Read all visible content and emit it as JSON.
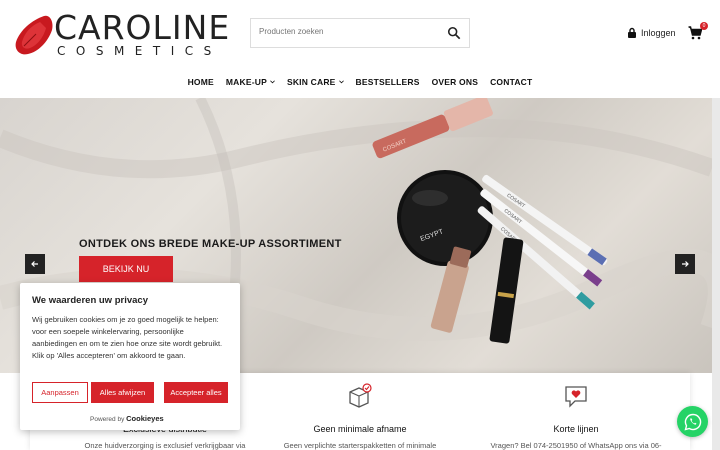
{
  "brand": {
    "name": "CAROLINE",
    "sub": "COSMETICS",
    "accent": "#d6232a"
  },
  "search": {
    "placeholder": "Producten zoeken"
  },
  "header": {
    "login_label": "Inloggen",
    "cart_count": "0"
  },
  "nav": [
    {
      "label": "HOME"
    },
    {
      "label": "MAKE-UP",
      "dropdown": true
    },
    {
      "label": "SKIN CARE",
      "dropdown": true
    },
    {
      "label": "BESTSELLERS"
    },
    {
      "label": "OVER ONS"
    },
    {
      "label": "CONTACT"
    }
  ],
  "hero": {
    "title": "ONTDEK ONS BREDE MAKE-UP ASSORTIMENT",
    "cta": "BEKIJK NU",
    "product_texts": [
      "EGYPT",
      "COSART",
      "COSART",
      "COSART"
    ]
  },
  "features": [
    {
      "icon": "leaf-icon",
      "title": "Exclusieve distributie",
      "text": "Onze huidverzorging is exclusief verkrijgbaar via"
    },
    {
      "icon": "box-check-icon",
      "title": "Geen minimale afname",
      "text": "Geen verplichte starterspakketten of minimale"
    },
    {
      "icon": "chat-heart-icon",
      "title": "Korte lijnen",
      "text": "Vragen? Bel 074-2501950 of WhatsApp ons via 06-"
    }
  ],
  "cookie": {
    "title": "We waarderen uw privacy",
    "text": "Wij gebruiken cookies om je zo goed mogelijk te helpen: voor een soepele winkelervaring, persoonlijke aanbiedingen en om te zien hoe onze site wordt gebruikt. Klik op 'Alles accepteren' om akkoord te gaan.",
    "customize": "Aanpassen",
    "reject": "Alles afwijzen",
    "accept": "Accepteer alles",
    "powered_by": "Powered by",
    "provider": "Cookieyes"
  }
}
